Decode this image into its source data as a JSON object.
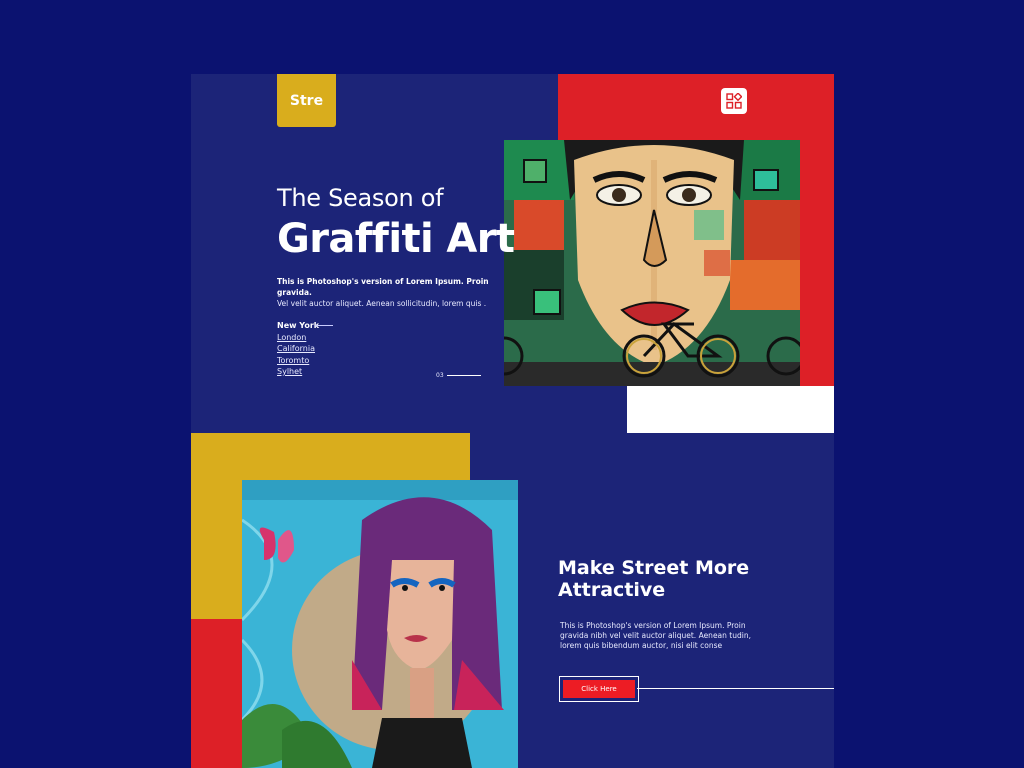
{
  "brand": {
    "logo_text": "Stre"
  },
  "header": {
    "menu_icon": "grid-menu-icon"
  },
  "hero": {
    "kicker": "The Season of",
    "title": "Graffiti Art",
    "desc_line1": "This is Photoshop's version  of Lorem Ipsum. Proin gravida.",
    "desc_line2": "Vel velit auctor aliquet. Aenean sollicitudin, lorem quis ."
  },
  "locations": {
    "items": [
      "New York",
      "London",
      "California",
      "Toromto",
      "Sylhet"
    ]
  },
  "pager": {
    "current": "03"
  },
  "section2": {
    "title_line1": "Make Street More",
    "title_line2": "Attractive",
    "desc": "This is Photoshop's version  of Lorem Ipsum. Proin gravida nibh vel velit auctor aliquet. Aenean tudin, lorem quis bibendum auctor, nisi elit conse",
    "cta_label": "Click Here"
  },
  "colors": {
    "background": "#0b1270",
    "panel": "#1c2478",
    "red": "#dd2027",
    "yellow": "#d9ad1d",
    "button": "#ed1c24"
  }
}
